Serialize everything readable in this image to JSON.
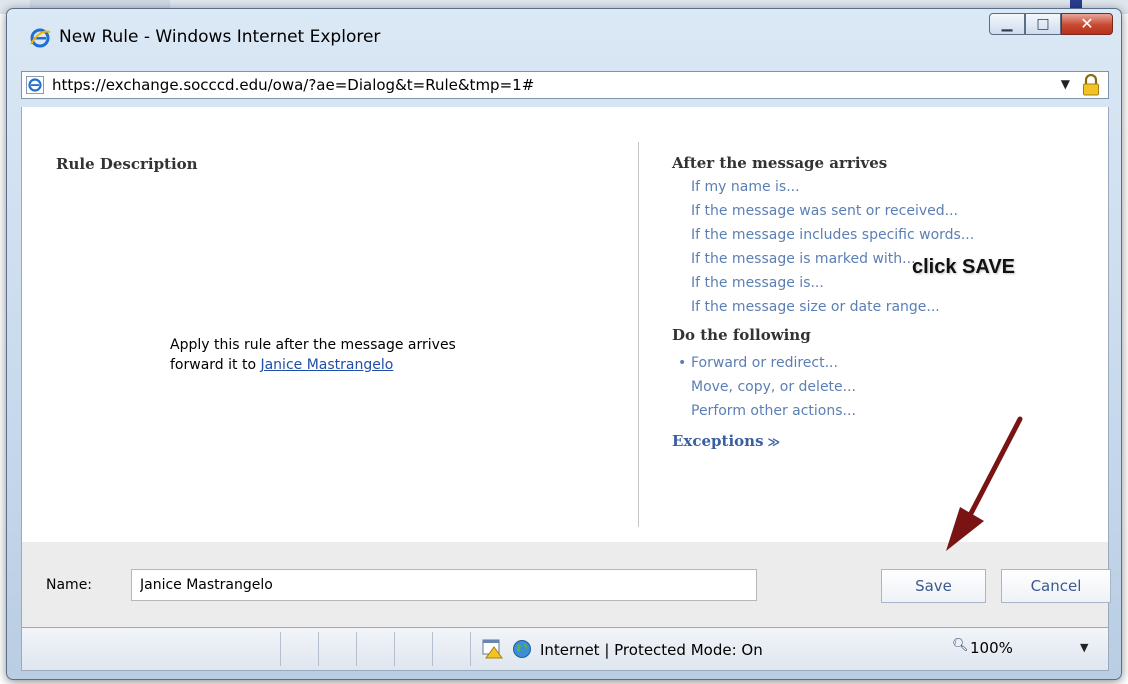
{
  "window": {
    "title": "New Rule - Windows Internet Explorer",
    "url": "https://exchange.socccd.edu/owa/?ae=Dialog&t=Rule&tmp=1#"
  },
  "rule_description": {
    "title": "Rule Description",
    "line1": "Apply this rule after the message arrives",
    "line2_prefix": "forward it to ",
    "line2_link": "Janice Mastrangelo"
  },
  "conditions": {
    "title": "After the message arrives",
    "items": [
      "If my name is...",
      "If the message was sent or received...",
      "If the message includes specific words...",
      "If the message is marked with...",
      "If the message is...",
      "If the message size or date range..."
    ]
  },
  "actions": {
    "title": "Do the following",
    "items": [
      "Forward or redirect...",
      "Move, copy, or delete...",
      "Perform other actions..."
    ]
  },
  "exceptions": {
    "label": "Exceptions",
    "chevron": "≫"
  },
  "annotation": {
    "text": "click SAVE",
    "arrow_color": "#7a1414"
  },
  "form": {
    "name_label": "Name:",
    "name_value": "Janice Mastrangelo",
    "save_label": "Save",
    "cancel_label": "Cancel"
  },
  "status": {
    "zone": "Internet | Protected Mode: On",
    "zoom": "100%"
  },
  "colors": {
    "link": "#5b7fb4",
    "annotation_arrow": "#7a1414"
  }
}
